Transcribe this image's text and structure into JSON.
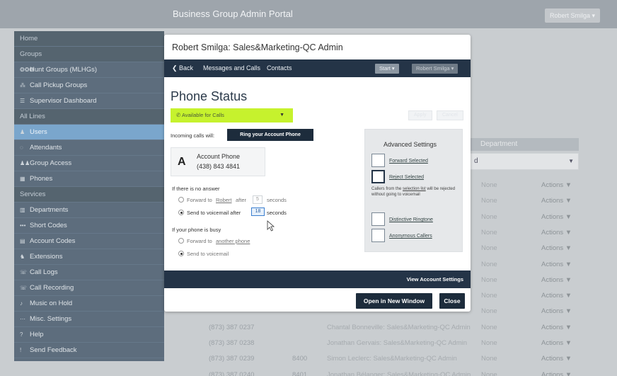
{
  "header": {
    "title": "Business Group Admin Portal",
    "user_menu": "Robert Smilga ▾"
  },
  "sidebar": {
    "items": [
      {
        "label": "Home",
        "icon": "",
        "kind": "header"
      },
      {
        "label": "Groups",
        "icon": "",
        "kind": "header"
      },
      {
        "label": "Hunt Groups (MLHGs)",
        "icon": "hunt-group-icon",
        "glyph": "❂❂❂",
        "kind": "item"
      },
      {
        "label": "Call Pickup Groups",
        "icon": "call-pickup-icon",
        "glyph": "⁂",
        "kind": "item"
      },
      {
        "label": "Supervisor Dashboard",
        "icon": "dashboard-icon",
        "glyph": "☰",
        "kind": "item"
      },
      {
        "label": "All Lines",
        "icon": "",
        "kind": "header"
      },
      {
        "label": "Users",
        "icon": "user-icon",
        "glyph": "♟",
        "kind": "active"
      },
      {
        "label": "Attendants",
        "icon": "attendant-icon",
        "glyph": "◌",
        "kind": "item"
      },
      {
        "label": "Group Access",
        "icon": "group-access-icon",
        "glyph": "♟♟",
        "kind": "item"
      },
      {
        "label": "Phones",
        "icon": "phone-grid-icon",
        "glyph": "▦",
        "kind": "item"
      },
      {
        "label": "Services",
        "icon": "",
        "kind": "header"
      },
      {
        "label": "Departments",
        "icon": "departments-icon",
        "glyph": "▥",
        "kind": "item"
      },
      {
        "label": "Short Codes",
        "icon": "short-codes-icon",
        "glyph": "•••",
        "kind": "item"
      },
      {
        "label": "Account Codes",
        "icon": "account-codes-icon",
        "glyph": "▤",
        "kind": "item"
      },
      {
        "label": "Extensions",
        "icon": "extensions-icon",
        "glyph": "♞",
        "kind": "item"
      },
      {
        "label": "Call Logs",
        "icon": "call-logs-icon",
        "glyph": "☏",
        "kind": "item"
      },
      {
        "label": "Call Recording",
        "icon": "call-recording-icon",
        "glyph": "☏",
        "kind": "item"
      },
      {
        "label": "Music on Hold",
        "icon": "music-icon",
        "glyph": "♪",
        "kind": "item"
      },
      {
        "label": "Misc. Settings",
        "icon": "misc-settings-icon",
        "glyph": "⋯",
        "kind": "item"
      },
      {
        "label": "Help",
        "icon": "help-icon",
        "glyph": "?",
        "kind": "item"
      },
      {
        "label": "Send Feedback",
        "icon": "feedback-icon",
        "glyph": "!",
        "kind": "item"
      }
    ]
  },
  "background": {
    "department_header": "Department",
    "department_select": "d",
    "table": {
      "rows": [
        {
          "phone": "",
          "ext": "",
          "name": "",
          "dept": "None",
          "actions": "Actions ▼"
        },
        {
          "phone": "",
          "ext": "",
          "name": "",
          "dept": "None",
          "actions": "Actions ▼"
        },
        {
          "phone": "",
          "ext": "",
          "name": "d...",
          "dept": "None",
          "actions": "Actions ▼"
        },
        {
          "phone": "",
          "ext": "",
          "name": "n",
          "dept": "None",
          "actions": "Actions ▼"
        },
        {
          "phone": "",
          "ext": "",
          "name": "in",
          "dept": "None",
          "actions": "Actions ▼"
        },
        {
          "phone": "",
          "ext": "",
          "name": "nin",
          "dept": "None",
          "actions": "Actions ▼"
        },
        {
          "phone": "",
          "ext": "",
          "name": "",
          "dept": "None",
          "actions": "Actions ▼"
        },
        {
          "phone": "",
          "ext": "",
          "name": "n",
          "dept": "None",
          "actions": "Actions ▼"
        },
        {
          "phone": "",
          "ext": "",
          "name": "",
          "dept": "None",
          "actions": "Actions ▼"
        },
        {
          "phone": "(873) 387 0237",
          "ext": "",
          "name": "Chantal Bonneville: Sales&Marketing-QC Admin",
          "dept": "None",
          "actions": "Actions ▼"
        },
        {
          "phone": "(873) 387 0238",
          "ext": "",
          "name": "Jonathan Gervais: Sales&Marketing-QC Admin",
          "dept": "None",
          "actions": "Actions ▼"
        },
        {
          "phone": "(873) 387 0239",
          "ext": "8400",
          "name": "Simon Leclerc: Sales&Marketing-QC Admin",
          "dept": "None",
          "actions": "Actions ▼"
        },
        {
          "phone": "(873) 387 0240",
          "ext": "8401",
          "name": "Jonathan Bélanger: Sales&Marketing-QC Admin",
          "dept": "None",
          "actions": "Actions ▼"
        }
      ]
    }
  },
  "modal": {
    "title": "Robert Smilga: Sales&Marketing-QC Admin",
    "nav": {
      "back": "Back",
      "messages": "Messages and Calls",
      "contacts": "Contacts",
      "start": "Start ▾",
      "user": "Robert Smilga ▾"
    },
    "phone_status_title": "Phone Status",
    "availability": "Available for Calls",
    "apply": "Apply",
    "cancel": "Cancel",
    "incoming_label": "Incoming calls will:",
    "ring_option": "Ring your Account Phone",
    "account_phone": {
      "letter": "A",
      "label": "Account Phone",
      "number": "(438) 843 4841"
    },
    "no_answer": {
      "heading": "If there is no answer",
      "forward_pre": "Forward to",
      "forward_link": "Robert",
      "forward_after": "after",
      "forward_secs": "5",
      "forward_unit": "seconds",
      "vm_pre": "Send to voicemail after",
      "vm_secs": "18",
      "vm_unit": "seconds"
    },
    "busy": {
      "heading": "If your phone is busy",
      "forward_pre": "Forward to",
      "forward_link": "another phone",
      "voicemail": "Send to voicemail"
    },
    "advanced": {
      "title": "Advanced Settings",
      "forward_selected": "Forward Selected",
      "reject_selected": "Reject Selected",
      "reject_note_1": "Callers from the",
      "reject_note_link": "selection list",
      "reject_note_2": "will be rejected without going to voicemail",
      "distinctive": "Distinctive Ringtone",
      "anonymous": "Anonymous Callers"
    },
    "view_account_settings": "View Account Settings",
    "open_new_window": "Open in New Window",
    "close": "Close"
  },
  "colors": {
    "accent_green": "#c6f22d",
    "navy": "#1d2c3c",
    "sidebar_active": "#7aa6cc"
  }
}
